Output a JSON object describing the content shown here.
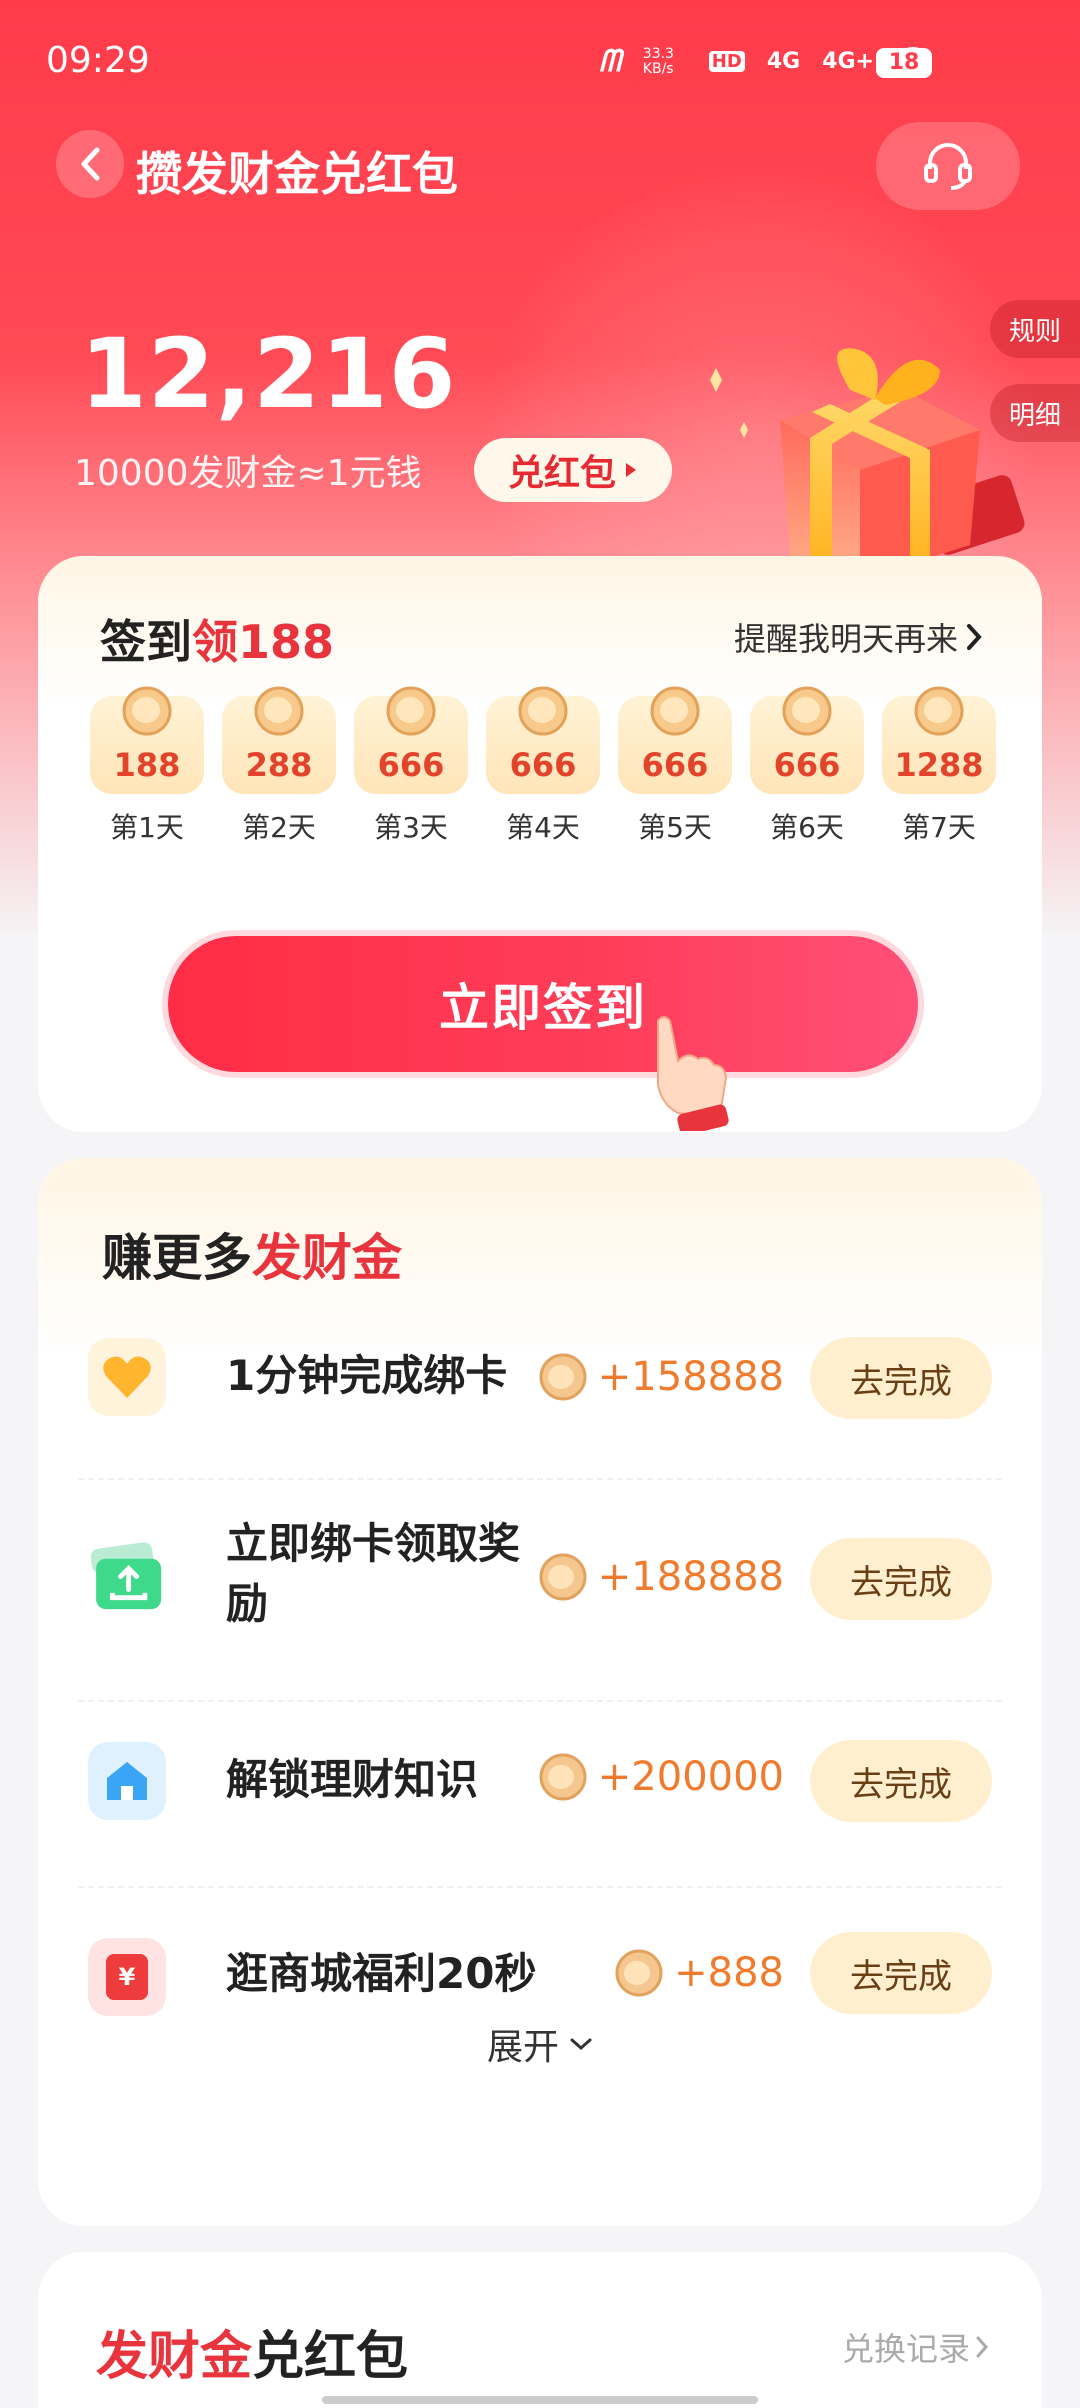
{
  "status_bar": {
    "time": "09:29",
    "net_speed": "33.3 KB/s",
    "hd_badge": "HD",
    "network_1": "4G",
    "network_2": "4G+",
    "battery": "18"
  },
  "nav": {
    "title": "攒发财金兑红包"
  },
  "side_tabs": {
    "rules": "规则",
    "details": "明细"
  },
  "balance": {
    "value": "12,216",
    "rate": "10000发财金≈1元钱",
    "redeem_label": "兑红包"
  },
  "checkin": {
    "title_prefix": "签到",
    "title_highlight": "领188",
    "remind_label": "提醒我明天再来",
    "days": [
      {
        "value": "188",
        "label": "第1天"
      },
      {
        "value": "288",
        "label": "第2天"
      },
      {
        "value": "666",
        "label": "第3天"
      },
      {
        "value": "666",
        "label": "第4天"
      },
      {
        "value": "666",
        "label": "第5天"
      },
      {
        "value": "666",
        "label": "第6天"
      },
      {
        "value": "1288",
        "label": "第7天"
      }
    ],
    "button_label": "立即签到"
  },
  "earn": {
    "title_prefix": "赚更多",
    "title_highlight": "发财金",
    "tasks": [
      {
        "name": "1分钟完成绑卡",
        "reward": "+158888",
        "button": "去完成",
        "icon": "heart-icon"
      },
      {
        "name": "立即绑卡领取奖励",
        "reward": "+188888",
        "button": "去完成",
        "icon": "card-upload-icon"
      },
      {
        "name": "解锁理财知识",
        "reward": "+200000",
        "button": "去完成",
        "icon": "house-icon"
      },
      {
        "name": "逛商城福利20秒",
        "reward": "+888",
        "button": "去完成",
        "icon": "yen-icon"
      }
    ],
    "expand_label": "展开"
  },
  "redeem": {
    "title_highlight": "发财金",
    "title_suffix": "兑红包",
    "record_label": "兑换记录"
  },
  "colors": {
    "brand_red": "#ff3b4a",
    "accent_orange": "#f07b2d",
    "button_cream": "#ffefcf"
  }
}
